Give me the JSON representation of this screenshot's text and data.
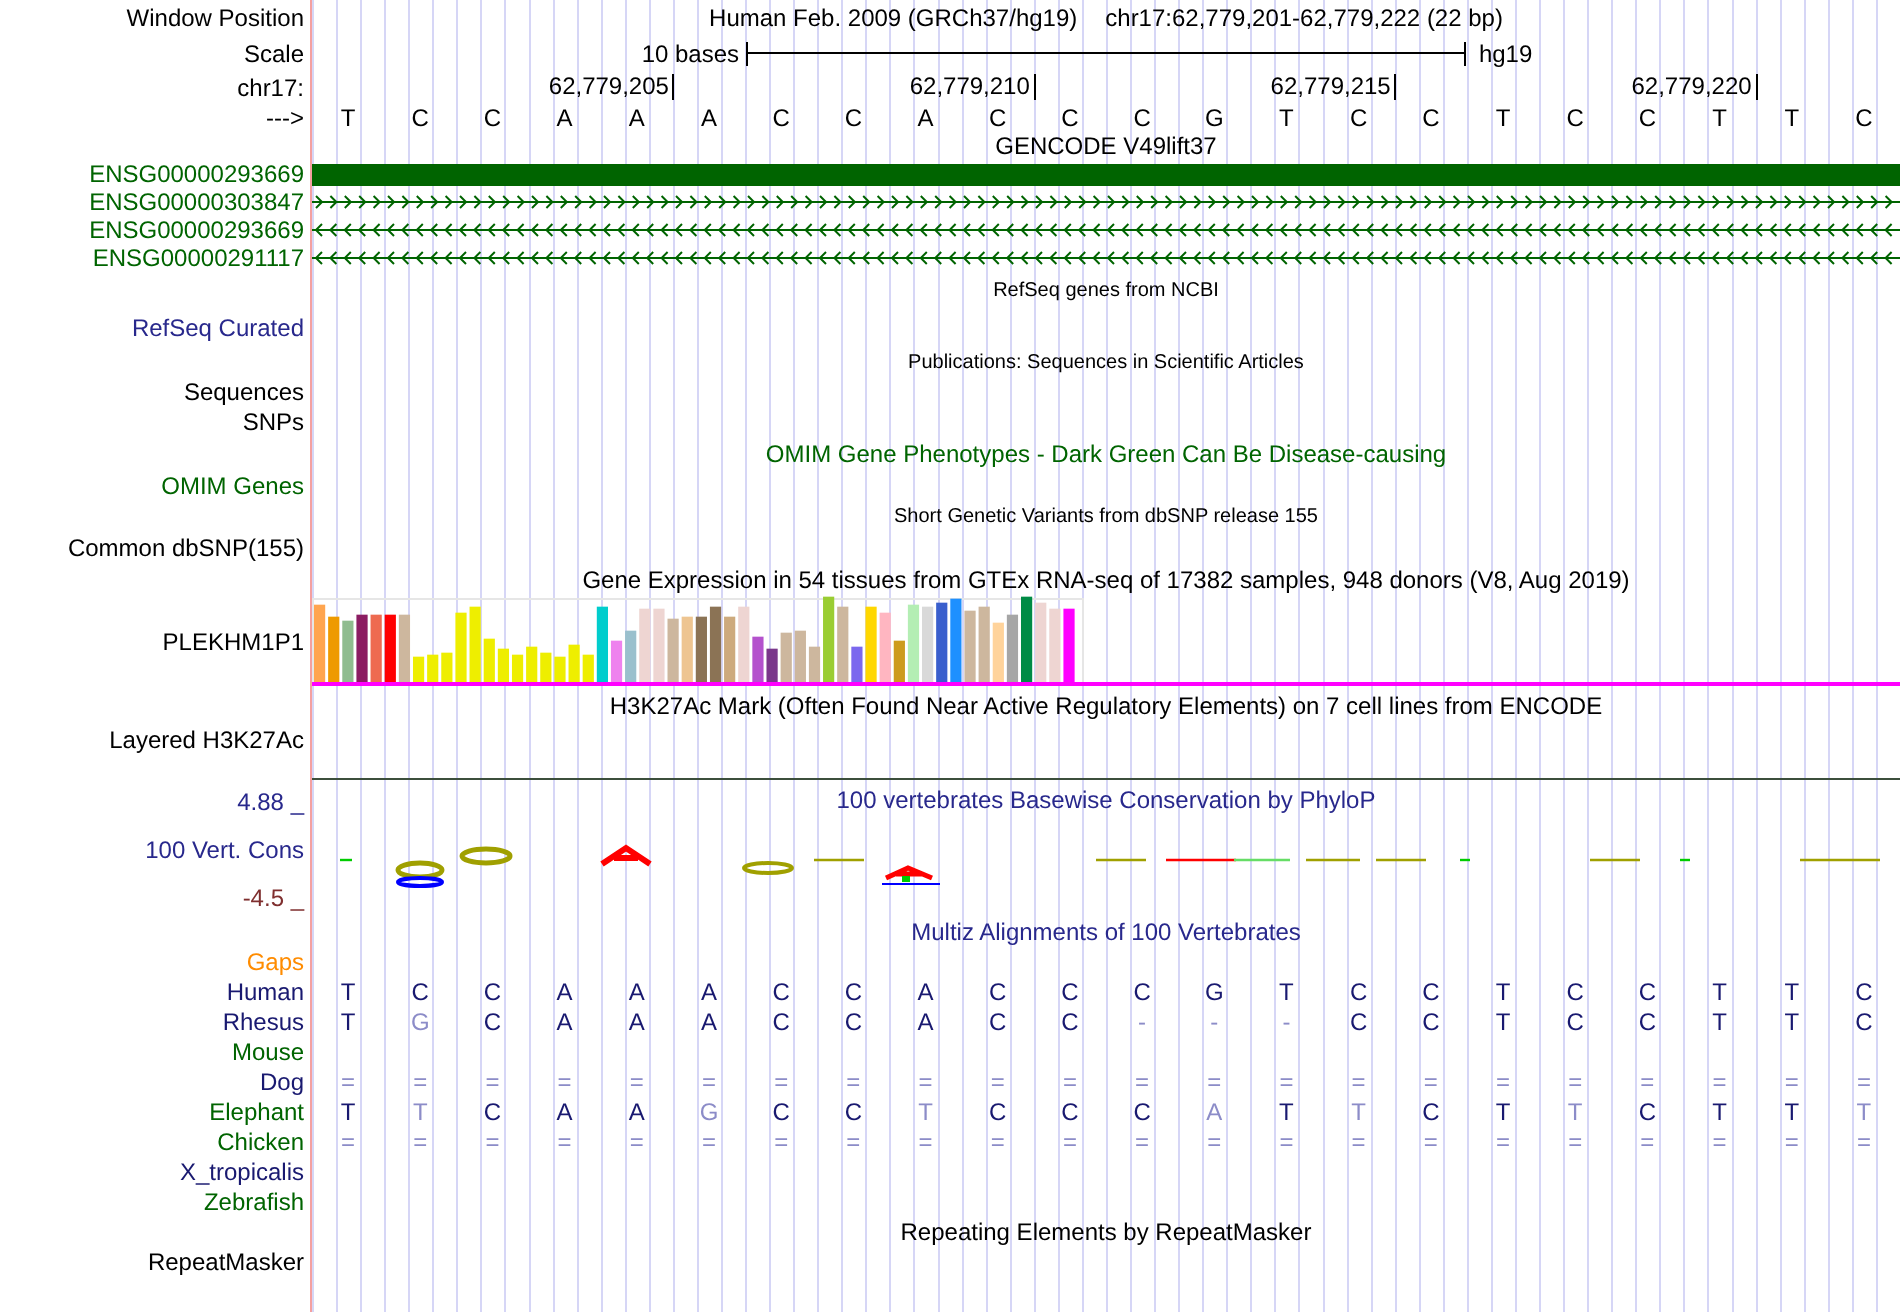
{
  "header": {
    "label": "Window Position",
    "assembly": "Human Feb. 2009 (GRCh37/hg19)",
    "position": "chr17:62,779,201-62,779,222 (22 bp)"
  },
  "scale": {
    "label": "Scale",
    "span": "10 bases",
    "assembly": "hg19"
  },
  "ruler": {
    "label": "chr17:",
    "ticks": [
      "62,779,205",
      "62,779,210",
      "62,779,215",
      "62,779,220"
    ]
  },
  "sequence": {
    "label": "--->",
    "bases": [
      "T",
      "C",
      "C",
      "A",
      "A",
      "A",
      "C",
      "C",
      "A",
      "C",
      "C",
      "C",
      "G",
      "T",
      "C",
      "C",
      "T",
      "C",
      "C",
      "T",
      "T",
      "C"
    ]
  },
  "gencode": {
    "title": "GENCODE V49lift37",
    "genes": [
      {
        "name": "ENSG00000293669",
        "kind": "block"
      },
      {
        "name": "ENSG00000303847",
        "kind": "forward"
      },
      {
        "name": "ENSG00000293669",
        "kind": "reverse"
      },
      {
        "name": "ENSG00000291117",
        "kind": "reverse"
      }
    ]
  },
  "refseq": {
    "title": "RefSeq genes from NCBI",
    "label": "RefSeq Curated"
  },
  "publications": {
    "title": "Publications: Sequences in Scientific Articles",
    "labels": [
      "Sequences",
      "SNPs"
    ]
  },
  "omim": {
    "title": "OMIM Gene Phenotypes - Dark Green Can Be Disease-causing",
    "label": "OMIM Genes"
  },
  "dbsnp": {
    "title": "Short Genetic Variants from dbSNP release 155",
    "label": "Common dbSNP(155)"
  },
  "gtex": {
    "title": "Gene Expression in 54 tissues from GTEx RNA-seq of 17382 samples, 948 donors (V8, Aug 2019)",
    "label": "PLEKHM1P1"
  },
  "h3k27ac": {
    "title": "H3K27Ac Mark (Often Found Near Active Regulatory Elements) on 7 cell lines from ENCODE",
    "label": "Layered H3K27Ac"
  },
  "conservation": {
    "title": "100 vertebrates Basewise Conservation by PhyloP",
    "label": "100 Vert. Cons",
    "max": "4.88 _",
    "min": "-4.5 _"
  },
  "multiz": {
    "title": "Multiz Alignments of 100 Vertebrates",
    "species": [
      {
        "name": "Gaps",
        "color": "#ff8c00"
      },
      {
        "name": "Human",
        "color": "#191970",
        "bases": [
          {
            "base": "T",
            "match": true
          },
          {
            "base": "C",
            "match": true
          },
          {
            "base": "C",
            "match": true
          },
          {
            "base": "A",
            "match": true
          },
          {
            "base": "A",
            "match": true
          },
          {
            "base": "A",
            "match": true
          },
          {
            "base": "C",
            "match": true
          },
          {
            "base": "C",
            "match": true
          },
          {
            "base": "A",
            "match": true
          },
          {
            "base": "C",
            "match": true
          },
          {
            "base": "C",
            "match": true
          },
          {
            "base": "C",
            "match": true
          },
          {
            "base": "G",
            "match": true
          },
          {
            "base": "T",
            "match": true
          },
          {
            "base": "C",
            "match": true
          },
          {
            "base": "C",
            "match": true
          },
          {
            "base": "T",
            "match": true
          },
          {
            "base": "C",
            "match": true
          },
          {
            "base": "C",
            "match": true
          },
          {
            "base": "T",
            "match": true
          },
          {
            "base": "T",
            "match": true
          },
          {
            "base": "C",
            "match": true
          }
        ]
      },
      {
        "name": "Rhesus",
        "color": "#191970",
        "bases": [
          {
            "base": "T",
            "match": true
          },
          {
            "base": "G",
            "match": false
          },
          {
            "base": "C",
            "match": true
          },
          {
            "base": "A",
            "match": true
          },
          {
            "base": "A",
            "match": true
          },
          {
            "base": "A",
            "match": true
          },
          {
            "base": "C",
            "match": true
          },
          {
            "base": "C",
            "match": true
          },
          {
            "base": "A",
            "match": true
          },
          {
            "base": "C",
            "match": true
          },
          {
            "base": "C",
            "match": true
          },
          {
            "base": "-",
            "match": false
          },
          {
            "base": "-",
            "match": false
          },
          {
            "base": "-",
            "match": false
          },
          {
            "base": "C",
            "match": true
          },
          {
            "base": "C",
            "match": true
          },
          {
            "base": "T",
            "match": true
          },
          {
            "base": "C",
            "match": true
          },
          {
            "base": "C",
            "match": true
          },
          {
            "base": "T",
            "match": true
          },
          {
            "base": "T",
            "match": true
          },
          {
            "base": "C",
            "match": true
          }
        ]
      },
      {
        "name": "Mouse",
        "color": "#006400"
      },
      {
        "name": "Dog",
        "color": "#191970",
        "bases": [
          {
            "base": "=",
            "match": false
          },
          {
            "base": "=",
            "match": false
          },
          {
            "base": "=",
            "match": false
          },
          {
            "base": "=",
            "match": false
          },
          {
            "base": "=",
            "match": false
          },
          {
            "base": "=",
            "match": false
          },
          {
            "base": "=",
            "match": false
          },
          {
            "base": "=",
            "match": false
          },
          {
            "base": "=",
            "match": false
          },
          {
            "base": "=",
            "match": false
          },
          {
            "base": "=",
            "match": false
          },
          {
            "base": "=",
            "match": false
          },
          {
            "base": "=",
            "match": false
          },
          {
            "base": "=",
            "match": false
          },
          {
            "base": "=",
            "match": false
          },
          {
            "base": "=",
            "match": false
          },
          {
            "base": "=",
            "match": false
          },
          {
            "base": "=",
            "match": false
          },
          {
            "base": "=",
            "match": false
          },
          {
            "base": "=",
            "match": false
          },
          {
            "base": "=",
            "match": false
          },
          {
            "base": "=",
            "match": false
          }
        ]
      },
      {
        "name": "Elephant",
        "color": "#006400",
        "bases": [
          {
            "base": "T",
            "match": true
          },
          {
            "base": "T",
            "match": false
          },
          {
            "base": "C",
            "match": true
          },
          {
            "base": "A",
            "match": true
          },
          {
            "base": "A",
            "match": true
          },
          {
            "base": "G",
            "match": false
          },
          {
            "base": "C",
            "match": true
          },
          {
            "base": "C",
            "match": true
          },
          {
            "base": "T",
            "match": false
          },
          {
            "base": "C",
            "match": true
          },
          {
            "base": "C",
            "match": true
          },
          {
            "base": "C",
            "match": true
          },
          {
            "base": "A",
            "match": false
          },
          {
            "base": "T",
            "match": true
          },
          {
            "base": "T",
            "match": false
          },
          {
            "base": "C",
            "match": true
          },
          {
            "base": "T",
            "match": true
          },
          {
            "base": "T",
            "match": false
          },
          {
            "base": "C",
            "match": true
          },
          {
            "base": "T",
            "match": true
          },
          {
            "base": "T",
            "match": true
          },
          {
            "base": "T",
            "match": false
          }
        ]
      },
      {
        "name": "Chicken",
        "color": "#006400",
        "bases": [
          {
            "base": "=",
            "match": false
          },
          {
            "base": "=",
            "match": false
          },
          {
            "base": "=",
            "match": false
          },
          {
            "base": "=",
            "match": false
          },
          {
            "base": "=",
            "match": false
          },
          {
            "base": "=",
            "match": false
          },
          {
            "base": "=",
            "match": false
          },
          {
            "base": "=",
            "match": false
          },
          {
            "base": "=",
            "match": false
          },
          {
            "base": "=",
            "match": false
          },
          {
            "base": "=",
            "match": false
          },
          {
            "base": "=",
            "match": false
          },
          {
            "base": "=",
            "match": false
          },
          {
            "base": "=",
            "match": false
          },
          {
            "base": "=",
            "match": false
          },
          {
            "base": "=",
            "match": false
          },
          {
            "base": "=",
            "match": false
          },
          {
            "base": "=",
            "match": false
          },
          {
            "base": "=",
            "match": false
          },
          {
            "base": "=",
            "match": false
          },
          {
            "base": "=",
            "match": false
          },
          {
            "base": "=",
            "match": false
          }
        ]
      },
      {
        "name": "X_tropicalis",
        "color": "#191970"
      },
      {
        "name": "Zebrafish",
        "color": "#006400"
      }
    ]
  },
  "repeatmasker": {
    "title": "Repeating Elements by RepeatMasker",
    "label": "RepeatMasker"
  }
}
